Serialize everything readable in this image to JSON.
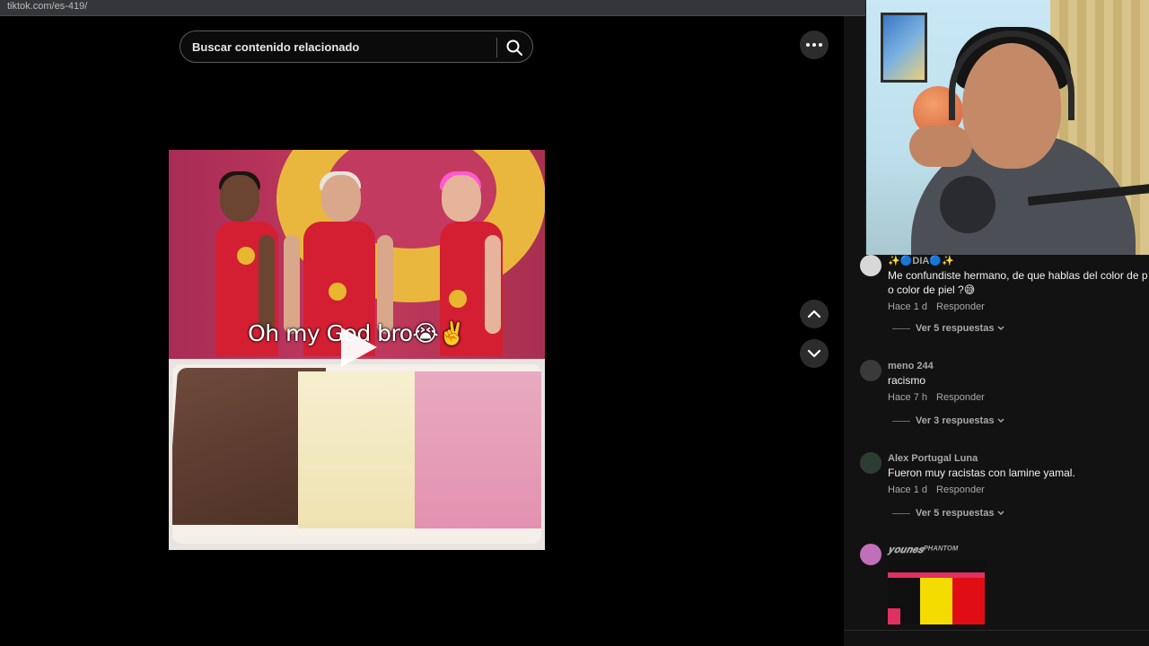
{
  "browser": {
    "url": "tiktok.com/es-419/"
  },
  "search": {
    "placeholder": "Buscar contenido relacionado"
  },
  "video": {
    "caption": "Oh my God bro😭✌️"
  },
  "comments": [
    {
      "user": "✨🔵DIA🔵✨",
      "text_line1": "Me confundiste hermano, de que hablas del color de p",
      "text_line2": "o color de piel ?😅",
      "time": "Hace 1 d",
      "reply_label": "Responder",
      "replies": "Ver 5 respuestas"
    },
    {
      "user": "meno 244",
      "text_line1": "racismo",
      "time": "Hace 7 h",
      "reply_label": "Responder",
      "replies": "Ver 3 respuestas"
    },
    {
      "user": "Alex Portugal Luna",
      "text_line1": "Fueron muy racistas con lamine yamal.",
      "time": "Hace 1 d",
      "reply_label": "Responder",
      "replies": "Ver 5 respuestas"
    },
    {
      "user": "𝒚𝒐𝒖𝒏𝒆𝒔ᴾᴴᴬᴺᵀᴼᴹ"
    }
  ],
  "colors": {
    "background": "#000000",
    "panel": "#121212",
    "text_muted": "#a8a8a8"
  },
  "icons": [
    "search-icon",
    "more-options-icon",
    "chevron-up-icon",
    "chevron-down-icon",
    "play-icon"
  ]
}
